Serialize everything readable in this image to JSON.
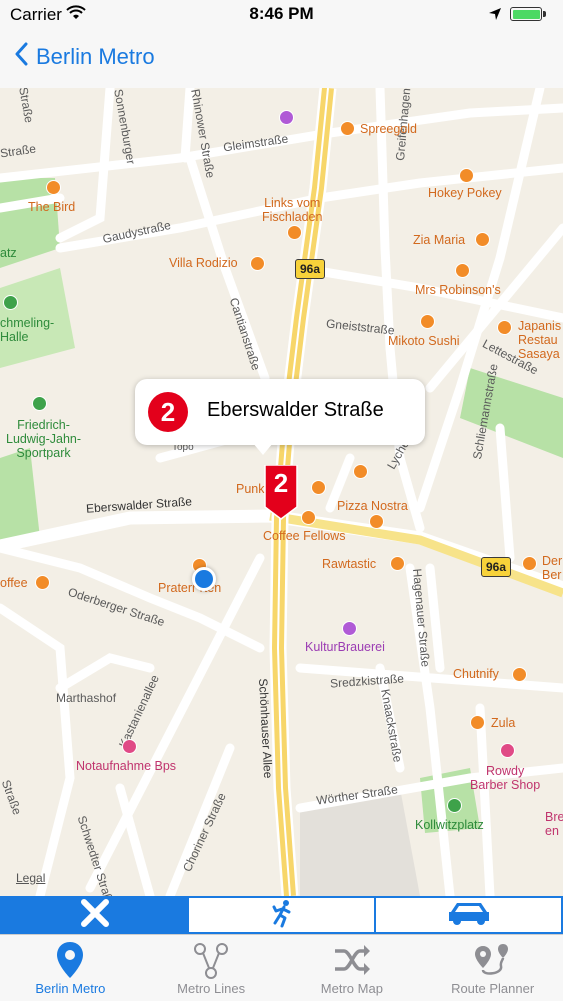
{
  "status_bar": {
    "carrier": "Carrier",
    "time": "8:46 PM"
  },
  "nav": {
    "back_label": "Berlin Metro"
  },
  "map": {
    "callout": {
      "line_number": "2",
      "station_name": "Eberswalder Straße"
    },
    "marker_line_number": "2",
    "legal": "Legal",
    "streets": {
      "s1": "Straße",
      "sonnenburger": "Sonnenburger",
      "rhinower": "Rhinower Straße",
      "gleim": "Gleimstraße",
      "gaudy": "Gaudystraße",
      "greifenhagener": "Greifenhagener Straße",
      "cantian": "Cantianstraße",
      "gneist": "Gneiststraße",
      "lette": "Lettestraße",
      "topo": "Topo",
      "eberswalder": "Eberswalder Straße",
      "lychener": "Lychener",
      "schliemann": "Schliemannstraße",
      "oderberger": "Oderberger Straße",
      "marthashof": "Marthashof",
      "kastanienallee": "Kastanienallee",
      "schoenhauser": "Schönhauser Allee",
      "sredzki": "Sredzkistraße",
      "hagenauer": "Hagenauer Straße",
      "knaack": "Knaackstraße",
      "woerther": "Wörther Straße",
      "choriner": "Choriner Straße",
      "schwedter": "Schwedter Straße",
      "left_strasse": "Straße",
      "left_strasse2": "Straße"
    },
    "shields": {
      "a": "96a",
      "b": "96a"
    },
    "pois": {
      "spreegold": "Spreegold",
      "hokey": "Hokey Pokey",
      "thebird": "The Bird",
      "links": "Links vom\nFischladen",
      "zia": "Zia Maria",
      "villa": "Villa Rodizio",
      "mrs": "Mrs Robinson's",
      "mikoto": "Mikoto Sushi",
      "japanis": "Japanis\nRestau\nSasaya",
      "atz": "atz",
      "schmeling": "chmeling-\nHalle",
      "jahn": "Friedrich-\nLudwig-Jahn-\nSportpark",
      "punk": "Punkt",
      "pizza": "Pizza Nostra",
      "coffee": "Coffee Fellows",
      "der": "Der\nBer",
      "rawtastic": "Rawtastic",
      "offee": "offee",
      "prater": "Praterr rten",
      "kultur": "KulturBrauerei",
      "chutnify": "Chutnify",
      "zula": "Zula",
      "notaufnahme": "Notaufnahme Bps",
      "rowdy": "Rowdy\nBarber Shop",
      "kollwitz": "Kollwitzplatz",
      "bre": "Bre\nen"
    }
  },
  "transport_modes": {
    "selected": "close",
    "options": [
      "close-icon",
      "walking-icon",
      "car-icon"
    ]
  },
  "tabs": [
    {
      "label": "Berlin Metro",
      "active": true
    },
    {
      "label": "Metro Lines",
      "active": false
    },
    {
      "label": "Metro Map",
      "active": false
    },
    {
      "label": "Route Planner",
      "active": false
    }
  ],
  "colors": {
    "accent": "#1a7ae0",
    "line2": "#e3001b",
    "road_major": "#f7d23a",
    "park": "#b7e1a6"
  }
}
